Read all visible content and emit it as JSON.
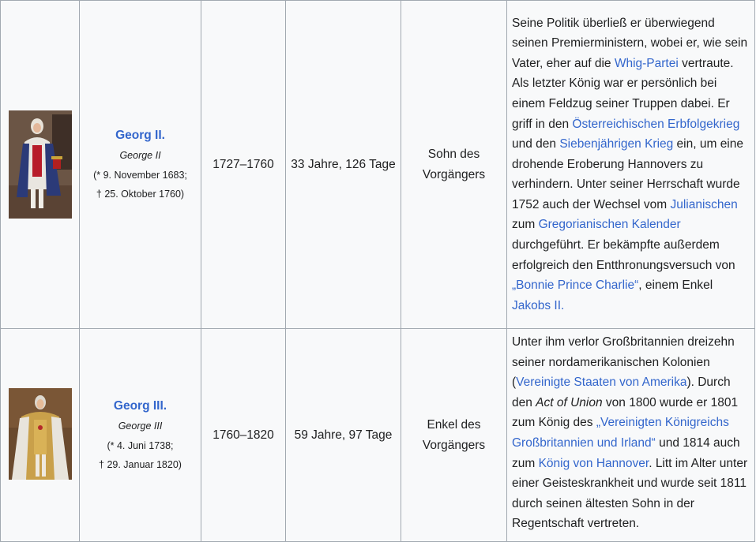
{
  "rows": [
    {
      "name": "Georg II.",
      "original_name": "George II",
      "born": "(* 9. November 1683;",
      "died": "† 25. Oktober 1760)",
      "reign": "1727–1760",
      "duration": "33 Jahre, 126 Tage",
      "relation": "Sohn des Vorgängers",
      "portrait_icon": "portrait-image",
      "notes": {
        "t1": "Seine Politik überließ er überwiegend seinen Premierministern, wobei er, wie sein Vater, eher auf die ",
        "l1": "Whig-Partei",
        "t2": " vertraute. Als letzter König war er persönlich bei einem Feldzug seiner Truppen dabei. Er griff in den ",
        "l2": "Österreichischen Erbfolgekrieg",
        "t3": " und den ",
        "l3": "Siebenjährigen Krieg",
        "t4": " ein, um eine drohende Eroberung Hannovers zu verhindern. Unter seiner Herrschaft wurde 1752 auch der Wechsel vom ",
        "l4": "Julianischen",
        "t5": " zum ",
        "l5": "Gregorianischen Kalender",
        "t6": " durchgeführt. Er bekämpfte außerdem erfolgreich den Entthronungsversuch von ",
        "l6": "„Bonnie Prince Charlie“",
        "t7": ", einem Enkel ",
        "l7": "Jakobs II.",
        "t8": ""
      }
    },
    {
      "name": "Georg III.",
      "original_name": "George III",
      "born": "(* 4. Juni 1738;",
      "died": "† 29. Januar 1820)",
      "reign": "1760–1820",
      "duration": "59 Jahre, 97 Tage",
      "relation": "Enkel des Vorgängers",
      "portrait_icon": "portrait-image",
      "notes": {
        "t1": "Unter ihm verlor Großbritannien dreizehn seiner nordamerikanischen Kolonien (",
        "l1": "Vereinigte Staaten von Amerika",
        "t2": "). Durch den ",
        "i1": "Act of Union",
        "t3": " von 1800 wurde er 1801 zum König des ",
        "l2": "„Vereinigten Königreichs Großbritannien und Irland“",
        "t4": " und 1814 auch zum ",
        "l3": "König von Hannover",
        "t5": ". Litt im Alter unter einer Geisteskrankheit und wurde seit 1811 durch seinen ältesten Sohn in der Regentschaft vertreten."
      }
    }
  ],
  "colors": {
    "link": "#3366cc",
    "cell_background": "#f8f9fa",
    "border": "#a2a9b1"
  }
}
